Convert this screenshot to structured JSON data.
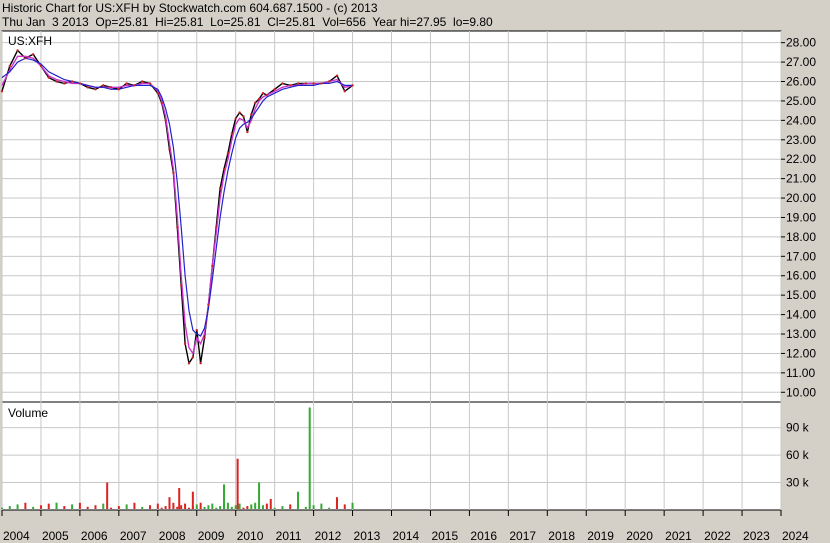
{
  "header": {
    "line1": "Historic Chart for US:XFH by Stockwatch.com 604.687.1500 - (c) 2013",
    "line2": "Thu Jan  3 2013  Op=25.81  Hi=25.81  Lo=25.81  Cl=25.81  Vol=656  Year hi=27.95  lo=9.80"
  },
  "chart_data": {
    "type": "line",
    "symbol_label": "US:XFH",
    "volume_label": "Volume",
    "y_ticks": [
      "28.00",
      "27.00",
      "26.00",
      "25.00",
      "24.00",
      "23.00",
      "22.00",
      "21.00",
      "20.00",
      "19.00",
      "18.00",
      "17.00",
      "16.00",
      "15.00",
      "14.00",
      "13.00",
      "12.00",
      "11.00",
      "10.00"
    ],
    "volume_ticks": [
      "90 k",
      "60 k",
      "30 k"
    ],
    "x_ticks": [
      "2004",
      "2005",
      "2006",
      "2007",
      "2008",
      "2009",
      "2010",
      "2011",
      "2012",
      "2013",
      "2014",
      "2015",
      "2016",
      "2017",
      "2018",
      "2019",
      "2020",
      "2021",
      "2022",
      "2023",
      "2024"
    ],
    "ylim": [
      9.5,
      28.6
    ],
    "volume_ylim": [
      0,
      118000
    ],
    "xlim": [
      2004.0,
      2024.0
    ],
    "colors": {
      "price": "#000000",
      "ma_short": "#cc33cc",
      "ma_long": "#2222cc",
      "vol_up": "#33aa33",
      "vol_down": "#dd2222",
      "grid": "#c8c8c8"
    },
    "price_series": {
      "x": [
        2004.0,
        2004.2,
        2004.4,
        2004.6,
        2004.8,
        2005.0,
        2005.2,
        2005.4,
        2005.6,
        2005.8,
        2006.0,
        2006.2,
        2006.4,
        2006.6,
        2006.8,
        2007.0,
        2007.2,
        2007.4,
        2007.6,
        2007.8,
        2008.0,
        2008.1,
        2008.2,
        2008.3,
        2008.4,
        2008.5,
        2008.6,
        2008.7,
        2008.8,
        2008.9,
        2009.0,
        2009.1,
        2009.2,
        2009.3,
        2009.4,
        2009.5,
        2009.6,
        2009.7,
        2009.8,
        2009.9,
        2010.0,
        2010.1,
        2010.2,
        2010.3,
        2010.4,
        2010.5,
        2010.6,
        2010.7,
        2010.8,
        2011.0,
        2011.2,
        2011.4,
        2011.6,
        2011.8,
        2012.0,
        2012.2,
        2012.4,
        2012.6,
        2012.8,
        2013.0
      ],
      "close": [
        25.5,
        26.8,
        27.6,
        27.2,
        27.4,
        26.8,
        26.2,
        26.0,
        25.9,
        26.0,
        25.9,
        25.7,
        25.6,
        25.8,
        25.7,
        25.6,
        25.9,
        25.8,
        26.0,
        25.9,
        25.4,
        24.9,
        24.0,
        22.5,
        21.3,
        18.5,
        15.5,
        12.5,
        11.5,
        11.8,
        13.2,
        11.5,
        12.8,
        14.5,
        16.5,
        18.5,
        20.5,
        21.5,
        22.3,
        23.3,
        24.1,
        24.4,
        24.2,
        23.4,
        24.3,
        24.9,
        25.1,
        25.4,
        25.3,
        25.6,
        25.9,
        25.8,
        25.9,
        25.9,
        25.9,
        25.9,
        26.0,
        26.3,
        25.5,
        25.8
      ],
      "ma_short": [
        25.8,
        26.6,
        27.3,
        27.3,
        27.2,
        26.8,
        26.3,
        26.1,
        26.0,
        25.9,
        25.9,
        25.8,
        25.7,
        25.7,
        25.7,
        25.7,
        25.8,
        25.8,
        25.9,
        25.9,
        25.5,
        25.0,
        24.2,
        22.8,
        21.5,
        19.0,
        16.0,
        13.5,
        12.3,
        12.0,
        12.8,
        12.5,
        13.0,
        14.5,
        16.5,
        18.2,
        20.0,
        21.2,
        22.0,
        23.0,
        23.8,
        24.1,
        24.0,
        23.6,
        24.0,
        24.6,
        25.0,
        25.2,
        25.3,
        25.5,
        25.7,
        25.8,
        25.8,
        25.9,
        25.9,
        25.9,
        26.0,
        26.1,
        25.7,
        25.8
      ],
      "ma_long": [
        26.2,
        26.5,
        27.0,
        27.2,
        27.1,
        26.9,
        26.5,
        26.3,
        26.1,
        26.0,
        25.9,
        25.8,
        25.7,
        25.7,
        25.6,
        25.6,
        25.7,
        25.8,
        25.8,
        25.8,
        25.6,
        25.2,
        24.6,
        23.8,
        22.6,
        20.8,
        18.5,
        16.0,
        14.2,
        13.2,
        13.0,
        12.9,
        13.3,
        14.3,
        15.8,
        17.4,
        19.0,
        20.3,
        21.4,
        22.3,
        23.1,
        23.6,
        23.8,
        23.9,
        24.1,
        24.4,
        24.7,
        25.0,
        25.2,
        25.4,
        25.6,
        25.7,
        25.8,
        25.8,
        25.8,
        25.9,
        25.9,
        26.0,
        25.8,
        25.8
      ]
    },
    "volume_spikes": [
      {
        "x": 2005.4,
        "value": 8000,
        "up": true
      },
      {
        "x": 2006.7,
        "value": 30000,
        "up": false
      },
      {
        "x": 2008.3,
        "value": 14000,
        "up": false
      },
      {
        "x": 2008.55,
        "value": 24000,
        "up": false
      },
      {
        "x": 2008.9,
        "value": 20000,
        "up": false
      },
      {
        "x": 2009.7,
        "value": 28000,
        "up": true
      },
      {
        "x": 2010.05,
        "value": 56000,
        "up": false
      },
      {
        "x": 2010.6,
        "value": 30000,
        "up": true
      },
      {
        "x": 2010.9,
        "value": 12000,
        "up": false
      },
      {
        "x": 2011.6,
        "value": 20000,
        "up": true
      },
      {
        "x": 2011.9,
        "value": 112000,
        "up": true
      },
      {
        "x": 2012.6,
        "value": 14000,
        "up": false
      }
    ]
  }
}
